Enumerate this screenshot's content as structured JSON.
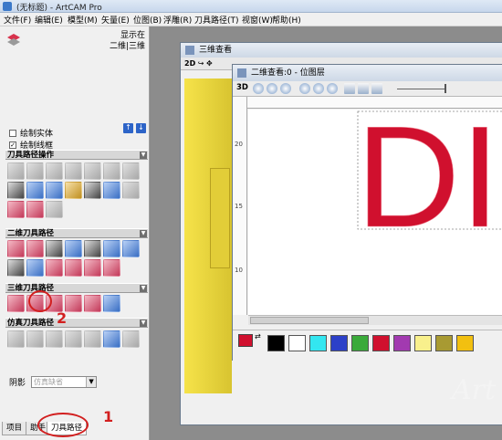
{
  "window": {
    "title": "(无标题) - ArtCAM Pro"
  },
  "menu": [
    "文件(F)",
    "编辑(E)",
    "模型(M)",
    "矢量(E)",
    "位图(B)",
    "浮雕(R)",
    "刀具路径(T)",
    "视窗(W)",
    "帮助(H)"
  ],
  "left_panel": {
    "view_label_1": "显示在",
    "view_label_2": "二维|三维",
    "checkbox_solid": "绘制实体",
    "checkbox_wireframe": "绘制线框",
    "section_ops": "刀具路径操作",
    "section_2d": "二维刀具路径",
    "section_3d": "三维刀具路径",
    "section_sim": "仿真刀具路径",
    "shadow_label": "阴影",
    "shadow_value": "仿真缺省"
  },
  "bottom_tabs": [
    "项目",
    "助手",
    "刀具路径"
  ],
  "annotations": {
    "label_1": "1",
    "label_2": "2"
  },
  "view3d": {
    "title": "三维查看",
    "toolbar_label": "2D"
  },
  "view2d": {
    "title": "二维查看:0 - 位图层",
    "toolbar_label": "3D",
    "ruler_labels": [
      "20",
      "15",
      "10"
    ],
    "canvas_text": "DI"
  },
  "palette": {
    "current": "#d0102e",
    "swatches": [
      "#000000",
      "#ffffff",
      "#33e6f0",
      "#2c40c8",
      "#3aaa3a",
      "#d0102e",
      "#a23ab0",
      "#f8f08c",
      "#a89a32",
      "#f2c010"
    ]
  },
  "watermark": "Art"
}
